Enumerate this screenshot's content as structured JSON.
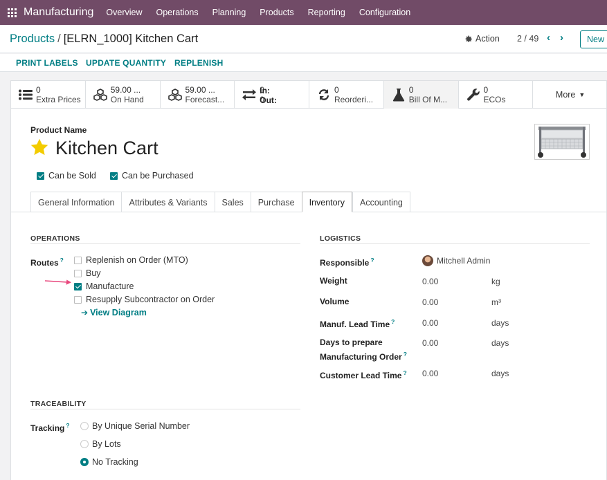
{
  "navbar": {
    "app_name": "Manufacturing",
    "menu": [
      "Overview",
      "Operations",
      "Planning",
      "Products",
      "Reporting",
      "Configuration"
    ]
  },
  "control": {
    "breadcrumb_parent": "Products",
    "breadcrumb_sep": "/",
    "breadcrumb_current": "[ELRN_1000] Kitchen Cart",
    "action_label": "Action",
    "pager": "2 / 49",
    "new_label": "New"
  },
  "statusbar": {
    "print_labels": "PRINT LABELS",
    "update_quantity": "UPDATE QUANTITY",
    "replenish": "REPLENISH"
  },
  "smart_buttons": {
    "extra_prices": {
      "value": "0",
      "label": "Extra Prices"
    },
    "on_hand": {
      "value": "59.00 ...",
      "label": "On Hand"
    },
    "forecast": {
      "value": "59.00 ...",
      "label": "Forecast..."
    },
    "in_out": {
      "in_label": "In:",
      "in_value": "0",
      "out_label": "Out:",
      "out_value": "0"
    },
    "reordering": {
      "value": "0",
      "label": "Reorderi..."
    },
    "bom": {
      "value": "0",
      "label": "Bill Of M..."
    },
    "ecos": {
      "value": "0",
      "label": "ECOs"
    },
    "more": "More"
  },
  "product": {
    "name_label": "Product Name",
    "name": "Kitchen Cart",
    "can_be_sold": "Can be Sold",
    "can_be_purchased": "Can be Purchased"
  },
  "tabs": [
    "General Information",
    "Attributes & Variants",
    "Sales",
    "Purchase",
    "Inventory",
    "Accounting"
  ],
  "operations": {
    "title": "OPERATIONS",
    "routes_label": "Routes",
    "routes": [
      {
        "label": "Replenish on Order (MTO)",
        "checked": false
      },
      {
        "label": "Buy",
        "checked": false
      },
      {
        "label": "Manufacture",
        "checked": true
      },
      {
        "label": "Resupply Subcontractor on Order",
        "checked": false
      }
    ],
    "view_diagram": "View Diagram"
  },
  "logistics": {
    "title": "LOGISTICS",
    "responsible_label": "Responsible",
    "responsible_value": "Mitchell Admin",
    "weight_label": "Weight",
    "weight_value": "0.00",
    "weight_unit": "kg",
    "volume_label": "Volume",
    "volume_value": "0.00",
    "volume_unit": "m³",
    "manuf_label": "Manuf. Lead Time",
    "manuf_value": "0.00",
    "manuf_unit": "days",
    "days_prepare_label_1": "Days to prepare",
    "days_prepare_label_2": "Manufacturing Order",
    "days_prepare_value": "0.00",
    "days_prepare_unit": "days",
    "customer_label": "Customer Lead Time",
    "customer_value": "0.00",
    "customer_unit": "days"
  },
  "traceability": {
    "title": "TRACEABILITY",
    "tracking_label": "Tracking",
    "options": [
      "By Unique Serial Number",
      "By Lots",
      "No Tracking"
    ],
    "selected": "No Tracking"
  },
  "colors": {
    "navbar": "#714b67",
    "accent": "#017e84",
    "star": "#f3cc00",
    "arrow": "#e8467c"
  }
}
